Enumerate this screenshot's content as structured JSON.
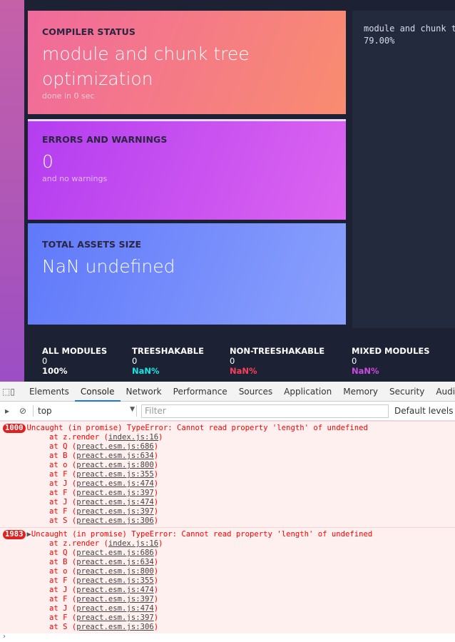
{
  "compiler": {
    "label": "COMPILER STATUS",
    "status": "module and chunk tree optimization",
    "sub": "done in 0 sec"
  },
  "errors": {
    "label": "ERRORS AND WARNINGS",
    "count": "0",
    "sub": "and no warnings"
  },
  "assets": {
    "label": "TOTAL ASSETS SIZE",
    "value": "NaN undefined"
  },
  "log": {
    "line1": "module and chunk tree optimization",
    "line2": "79.00%"
  },
  "stats": [
    {
      "label": "ALL MODULES",
      "count": "0",
      "pct": "100%",
      "color": "#ffffff"
    },
    {
      "label": "TREESHAKABLE",
      "count": "0",
      "pct": "NaN%",
      "color": "#19e3e3"
    },
    {
      "label": "NON-TREESHAKABLE",
      "count": "0",
      "pct": "NaN%",
      "color": "#f5425a"
    },
    {
      "label": "MIXED MODULES",
      "count": "0",
      "pct": "NaN%",
      "color": "#c94de0"
    }
  ],
  "devtools": {
    "tabs": [
      "Elements",
      "Console",
      "Network",
      "Performance",
      "Sources",
      "Application",
      "Memory",
      "Security",
      "Audits"
    ],
    "context": "top",
    "filter_placeholder": "Filter",
    "levels": "Default levels",
    "messages": [
      {
        "count": "1000",
        "text": "Uncaught (in promise) TypeError: Cannot read property 'length' of undefined",
        "frames": [
          [
            "at z.render (",
            "index.js:16"
          ],
          [
            "at Q (",
            "preact.esm.js:686"
          ],
          [
            "at B (",
            "preact.esm.js:634"
          ],
          [
            "at o (",
            "preact.esm.js:800"
          ],
          [
            "at F (",
            "preact.esm.js:355"
          ],
          [
            "at J (",
            "preact.esm.js:474"
          ],
          [
            "at F (",
            "preact.esm.js:397"
          ],
          [
            "at J (",
            "preact.esm.js:474"
          ],
          [
            "at F (",
            "preact.esm.js:397"
          ],
          [
            "at S (",
            "preact.esm.js:306"
          ]
        ]
      },
      {
        "count": "1983",
        "text": "Uncaught (in promise) TypeError: Cannot read property 'length' of undefined",
        "frames": [
          [
            "at z.render (",
            "index.js:16"
          ],
          [
            "at Q (",
            "preact.esm.js:686"
          ],
          [
            "at B (",
            "preact.esm.js:634"
          ],
          [
            "at o (",
            "preact.esm.js:800"
          ],
          [
            "at F (",
            "preact.esm.js:355"
          ],
          [
            "at J (",
            "preact.esm.js:474"
          ],
          [
            "at F (",
            "preact.esm.js:397"
          ],
          [
            "at J (",
            "preact.esm.js:474"
          ],
          [
            "at F (",
            "preact.esm.js:397"
          ],
          [
            "at S (",
            "preact.esm.js:306"
          ]
        ]
      }
    ]
  }
}
